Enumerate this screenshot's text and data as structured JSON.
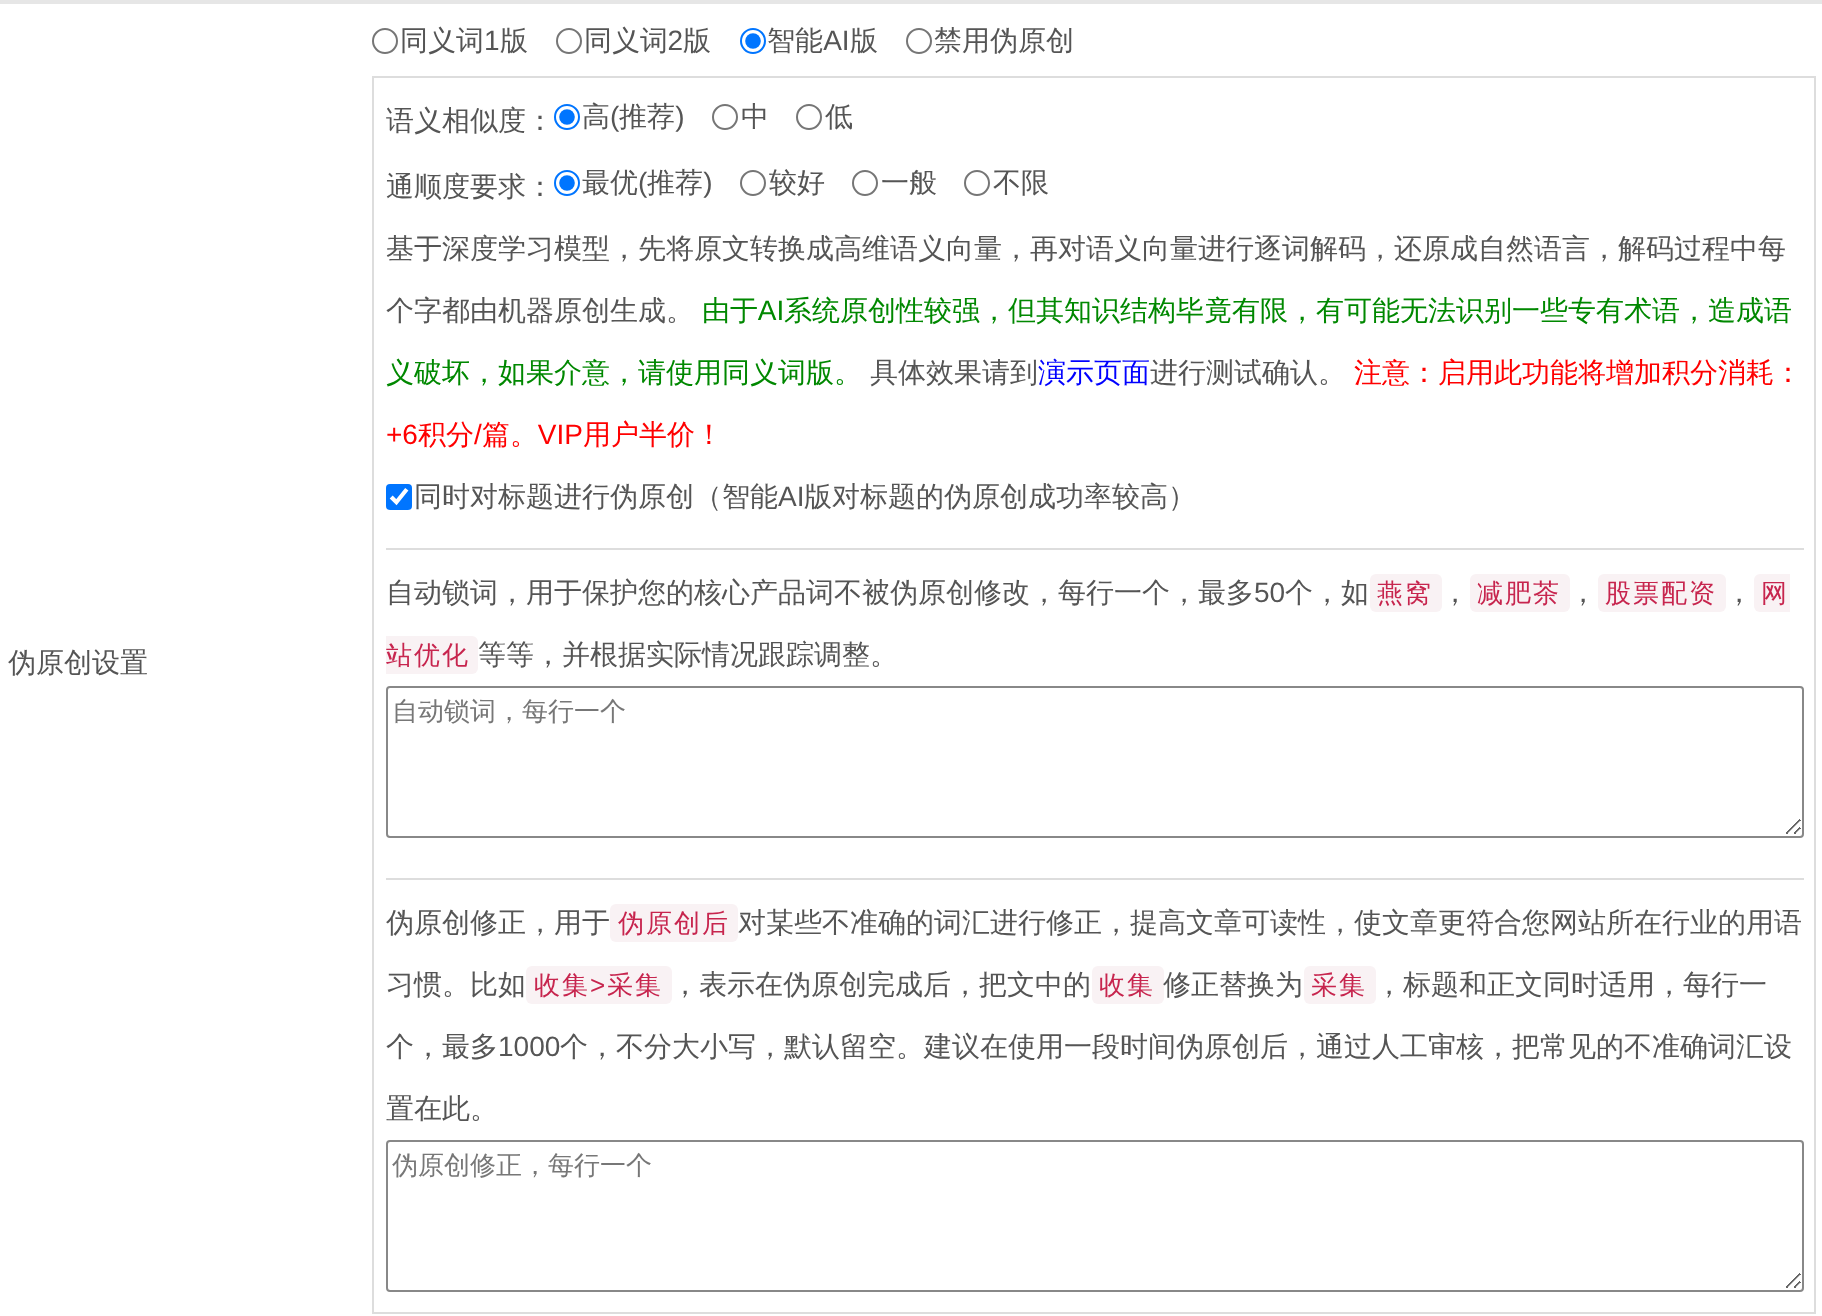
{
  "mode_options": [
    {
      "label": "同义词1版",
      "selected": false
    },
    {
      "label": "同义词2版",
      "selected": false
    },
    {
      "label": "智能AI版",
      "selected": true
    },
    {
      "label": "禁用伪原创",
      "selected": false
    }
  ],
  "settings_label": "伪原创设置",
  "ai_panel": {
    "similarity": {
      "label": "语义相似度：",
      "options": [
        {
          "label": "高(推荐)",
          "selected": true
        },
        {
          "label": "中",
          "selected": false
        },
        {
          "label": "低",
          "selected": false
        }
      ]
    },
    "fluency": {
      "label": "通顺度要求：",
      "options": [
        {
          "label": "最优(推荐)",
          "selected": true
        },
        {
          "label": "较好",
          "selected": false
        },
        {
          "label": "一般",
          "selected": false
        },
        {
          "label": "不限",
          "selected": false
        }
      ]
    },
    "description": [
      {
        "kind": "text",
        "text": "基于深度学习模型，先将原文转换成高维语义向量，再对语义向量进行逐词解码，还原成自然语言，解码过程中每个字都由机器原创生成。 "
      },
      {
        "kind": "note",
        "text": "由于AI系统原创性较强，但其知识结构毕竟有限，有可能无法识别一些专有术语，造成语义破坏，如果介意，请使用同义词版。"
      },
      {
        "kind": "text",
        "text": " 具体效果请到"
      },
      {
        "kind": "link",
        "text": "演示页面"
      },
      {
        "kind": "text",
        "text": "进行测试确认。 "
      },
      {
        "kind": "warning",
        "text": "注意：启用此功能将增加积分消耗：+6积分/篇。VIP用户半价！"
      }
    ],
    "title_option": {
      "label": "同时对标题进行伪原创（智能AI版对标题的伪原创成功率较高）",
      "checked": true
    }
  },
  "lock_words": {
    "description": [
      {
        "kind": "text",
        "text": "自动锁词，用于保护您的核心产品词不被伪原创修改，每行一个，最多50个，如"
      },
      {
        "kind": "code",
        "text": "燕窝"
      },
      {
        "kind": "text",
        "text": "，"
      },
      {
        "kind": "code",
        "text": "减肥茶"
      },
      {
        "kind": "text",
        "text": "，"
      },
      {
        "kind": "code",
        "text": "股票配资"
      },
      {
        "kind": "text",
        "text": "，"
      },
      {
        "kind": "code",
        "text": "网站优化"
      },
      {
        "kind": "text",
        "text": "等等，并根据实际情况跟踪调整。"
      }
    ],
    "placeholder": "自动锁词，每行一个"
  },
  "corrections": {
    "description": [
      {
        "kind": "text",
        "text": "伪原创修正，用于"
      },
      {
        "kind": "code",
        "text": "伪原创后"
      },
      {
        "kind": "text",
        "text": "对某些不准确的词汇进行修正，提高文章可读性，使文章更符合您网站所在行业的用语习惯。比如"
      },
      {
        "kind": "code",
        "text": "收集>采集"
      },
      {
        "kind": "text",
        "text": "，表示在伪原创完成后，把文中的"
      },
      {
        "kind": "code",
        "text": "收集"
      },
      {
        "kind": "text",
        "text": "修正替换为"
      },
      {
        "kind": "code",
        "text": "采集"
      },
      {
        "kind": "text",
        "text": "，标题和正文同时适用，每行一个，最多1000个，不分大小写，默认留空。建议在使用一段时间伪原创后，通过人工审核，把常见的不准确词汇设置在此。"
      }
    ],
    "placeholder": "伪原创修正，每行一个"
  }
}
